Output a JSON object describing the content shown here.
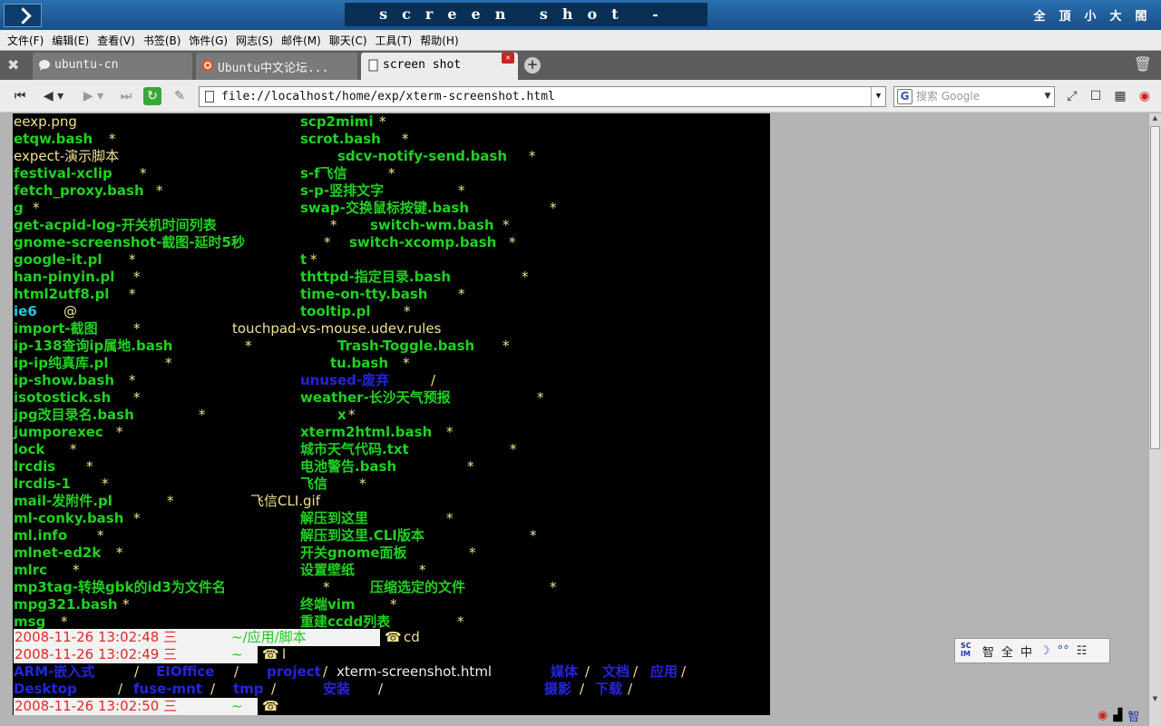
{
  "window": {
    "title": "screen shot - Opera",
    "title_buttons": [
      "全",
      "頂",
      "小",
      "大",
      "閤"
    ]
  },
  "menu": [
    "文件(F)",
    "编辑(E)",
    "查看(V)",
    "书签(B)",
    "饰件(G)",
    "网志(S)",
    "邮件(M)",
    "聊天(C)",
    "工具(T)",
    "帮助(H)"
  ],
  "tabs": [
    {
      "label": "ubuntu-cn"
    },
    {
      "label": "Ubuntu中文论坛..."
    },
    {
      "label": "screen shot"
    }
  ],
  "address": {
    "url": "file://localhost/home/exp/xterm-screenshot.html",
    "search_placeholder": "搜索 Google"
  },
  "terminal": {
    "left_column": [
      {
        "text": "eexp.png",
        "color": "y"
      },
      {
        "text": "etqw.bash",
        "color": "g",
        "star": "*"
      },
      {
        "text": "expect-演示脚本",
        "color": "y"
      },
      {
        "text": "festival-xclip",
        "color": "g",
        "star": "*"
      },
      {
        "text": "fetch_proxy.bash",
        "color": "g",
        "star": "*"
      },
      {
        "text": "g",
        "color": "g",
        "star": "*"
      },
      {
        "text": "get-acpid-log-开关机时间列表",
        "color": "g",
        "star": "*"
      },
      {
        "text": "gnome-screenshot-截图-延时5秒",
        "color": "g",
        "star": "*"
      },
      {
        "text": "google-it.pl",
        "color": "g",
        "star": "*"
      },
      {
        "text": "han-pinyin.pl",
        "color": "g",
        "star": "*"
      },
      {
        "text": "html2utf8.pl",
        "color": "g",
        "star": "*"
      },
      {
        "text": "ie6",
        "color": "c",
        "star": "@"
      },
      {
        "text": "import-截图",
        "color": "g",
        "star": "*"
      },
      {
        "text": "ip-138查询ip属地.bash",
        "color": "g",
        "star": "*"
      },
      {
        "text": "ip-ip纯真库.pl",
        "color": "g",
        "star": "*"
      },
      {
        "text": "ip-show.bash",
        "color": "g",
        "star": "*"
      },
      {
        "text": "isotostick.sh",
        "color": "g",
        "star": "*"
      },
      {
        "text": "jpg改目录名.bash",
        "color": "g",
        "star": "*"
      },
      {
        "text": "jumporexec",
        "color": "g",
        "star": "*"
      },
      {
        "text": "lock",
        "color": "g",
        "star": "*"
      },
      {
        "text": "lrcdis",
        "color": "g",
        "star": "*"
      },
      {
        "text": "lrcdis-1",
        "color": "g",
        "star": "*"
      },
      {
        "text": "mail-发附件.pl",
        "color": "g",
        "star": "*"
      },
      {
        "text": "ml-conky.bash",
        "color": "g",
        "star": "*"
      },
      {
        "text": "ml.info",
        "color": "g",
        "star": "*"
      },
      {
        "text": "mlnet-ed2k",
        "color": "g",
        "star": "*"
      },
      {
        "text": "mlrc",
        "color": "g",
        "star": "*"
      },
      {
        "text": "mp3tag-转换gbk的id3为文件名",
        "color": "g",
        "star": "*"
      },
      {
        "text": "mpg321.bash",
        "color": "g",
        "star": "*"
      },
      {
        "text": "msg",
        "color": "g",
        "star": "*"
      }
    ],
    "right_column": [
      {
        "text": "scp2mimi",
        "color": "g",
        "star": "*"
      },
      {
        "text": "scrot.bash",
        "color": "g",
        "star": "*"
      },
      {
        "text": "sdcv-notify-send.bash",
        "color": "g",
        "star": "*"
      },
      {
        "text": "s-f飞信",
        "color": "g",
        "star": "*"
      },
      {
        "text": "s-p-竖排文字",
        "color": "g",
        "star": "*"
      },
      {
        "text": "swap-交换鼠标按键.bash",
        "color": "g",
        "star": "*"
      },
      {
        "text": "switch-wm.bash",
        "color": "g",
        "star": "*"
      },
      {
        "text": "switch-xcomp.bash",
        "color": "g",
        "star": "*"
      },
      {
        "text": "t",
        "color": "g",
        "star": "*"
      },
      {
        "text": "thttpd-指定目录.bash",
        "color": "g",
        "star": "*"
      },
      {
        "text": "time-on-tty.bash",
        "color": "g",
        "star": "*"
      },
      {
        "text": "tooltip.pl",
        "color": "g",
        "star": "*"
      },
      {
        "text": "touchpad-vs-mouse.udev.rules",
        "color": "y",
        "star": ""
      },
      {
        "text": "Trash-Toggle.bash",
        "color": "g",
        "star": "*"
      },
      {
        "text": "tu.bash",
        "color": "g",
        "star": "*"
      },
      {
        "text": "unused-废弃",
        "color": "b",
        "star": "/"
      },
      {
        "text": "weather-长沙天气预报",
        "color": "g",
        "star": "*"
      },
      {
        "text": "x",
        "color": "g",
        "star": "*"
      },
      {
        "text": "xterm2html.bash",
        "color": "g",
        "star": "*"
      },
      {
        "text": "城市天气代码.txt",
        "color": "g",
        "star": "*"
      },
      {
        "text": "电池警告.bash",
        "color": "g",
        "star": "*"
      },
      {
        "text": "飞信",
        "color": "g",
        "star": "*"
      },
      {
        "text": "飞信CLI.gif",
        "color": "y",
        "star": ""
      },
      {
        "text": "解压到这里",
        "color": "g",
        "star": "*"
      },
      {
        "text": "解压到这里.CLI版本",
        "color": "g",
        "star": "*"
      },
      {
        "text": "开关gnome面板",
        "color": "g",
        "star": "*"
      },
      {
        "text": "设置壁纸",
        "color": "g",
        "star": "*"
      },
      {
        "text": "压缩选定的文件",
        "color": "g",
        "star": "*"
      },
      {
        "text": "终端vim",
        "color": "g",
        "star": "*"
      },
      {
        "text": "重建ccdd列表",
        "color": "g",
        "star": "*"
      }
    ],
    "prompts": [
      {
        "timestamp": "2008-11-26 13:02:48 三",
        "cwd": "~/应用/脚本",
        "command": "cd"
      },
      {
        "timestamp": "2008-11-26 13:02:49 三",
        "cwd": "~",
        "command": "l"
      },
      {
        "timestamp": "2008-11-26 13:02:50 三",
        "cwd": "~",
        "command": ""
      }
    ],
    "phone_glyph": "☎",
    "home_listing": {
      "row1": [
        "ARM-嵌入式",
        "/",
        "EIOffice",
        "/",
        "project",
        "/",
        "xterm-screenshot.html",
        "媒体",
        "/",
        "文档",
        "/",
        "应用",
        "/"
      ],
      "row2": [
        "Desktop",
        "/",
        "fuse-mnt",
        "/",
        "tmp",
        "/",
        "安装",
        "/",
        "摄影",
        "/",
        "下载",
        "/"
      ]
    }
  },
  "ime": [
    "智",
    "全",
    "中",
    "☽",
    "°°",
    "☷"
  ],
  "tray": [
    "智"
  ]
}
